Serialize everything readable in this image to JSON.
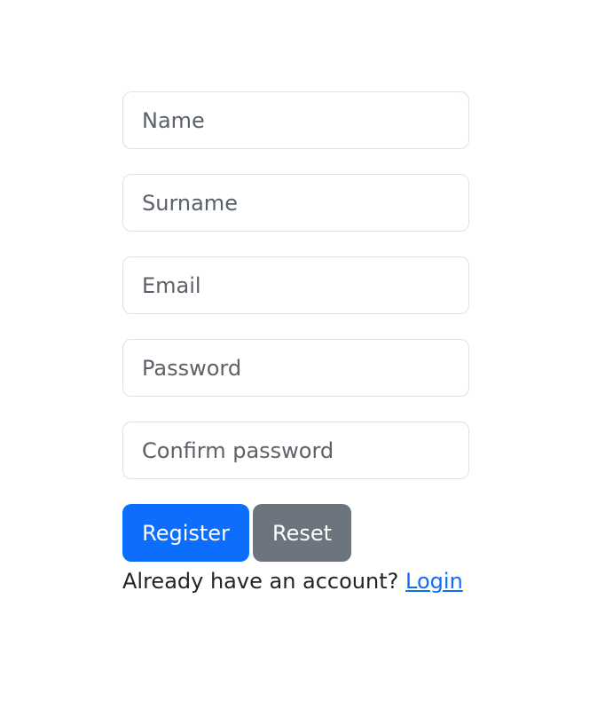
{
  "form": {
    "fields": {
      "name": {
        "placeholder": "Name",
        "value": ""
      },
      "surname": {
        "placeholder": "Surname",
        "value": ""
      },
      "email": {
        "placeholder": "Email",
        "value": ""
      },
      "password": {
        "placeholder": "Password",
        "value": ""
      },
      "confirm_password": {
        "placeholder": "Confirm password",
        "value": ""
      }
    },
    "buttons": {
      "register_label": "Register",
      "reset_label": "Reset"
    },
    "login_prompt": {
      "text": "Already have an account?",
      "link_label": "Login"
    }
  },
  "colors": {
    "primary": "#0d6efd",
    "secondary": "#6c757d",
    "border": "#dee2e6",
    "text": "#212529",
    "placeholder": "#5b6168"
  }
}
